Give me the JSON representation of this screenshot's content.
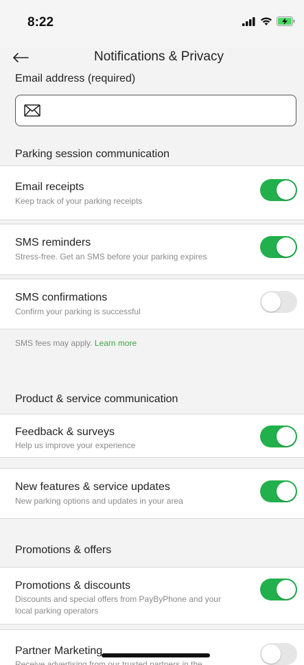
{
  "status_bar": {
    "time": "8:22"
  },
  "header": {
    "title": "Notifications & Privacy"
  },
  "email": {
    "label": "Email address (required)",
    "value": "",
    "placeholder": ""
  },
  "sections": {
    "parking": "Parking session communication",
    "product": "Product & service communication",
    "promotions": "Promotions & offers"
  },
  "rows": {
    "email_receipts": {
      "title": "Email receipts",
      "subtitle": "Keep track of your parking receipts",
      "enabled": true
    },
    "sms_reminders": {
      "title": "SMS reminders",
      "subtitle": "Stress-free. Get an SMS before your parking expires",
      "enabled": true
    },
    "sms_confirmations": {
      "title": "SMS confirmations",
      "subtitle": "Confirm your parking is successful",
      "enabled": false
    },
    "feedback": {
      "title": "Feedback & surveys",
      "subtitle": "Help us improve your experience",
      "enabled": true
    },
    "new_features": {
      "title": "New features & service updates",
      "subtitle": "New parking options and updates in your area",
      "enabled": true
    },
    "promotions": {
      "title": "Promotions & discounts",
      "subtitle_line1": "Discounts and special offers from PayByPhone and your",
      "subtitle_line2": "local parking operators",
      "enabled": true
    },
    "partner": {
      "title": "Partner Marketing",
      "subtitle": "Receive advertising from our trusted partners in the",
      "enabled": false
    }
  },
  "sms_note": {
    "text": "SMS fees may apply.",
    "link": "Learn more"
  },
  "colors": {
    "toggle_on": "#22b04c",
    "toggle_off": "#e6e6e6",
    "link": "#3aa843"
  }
}
